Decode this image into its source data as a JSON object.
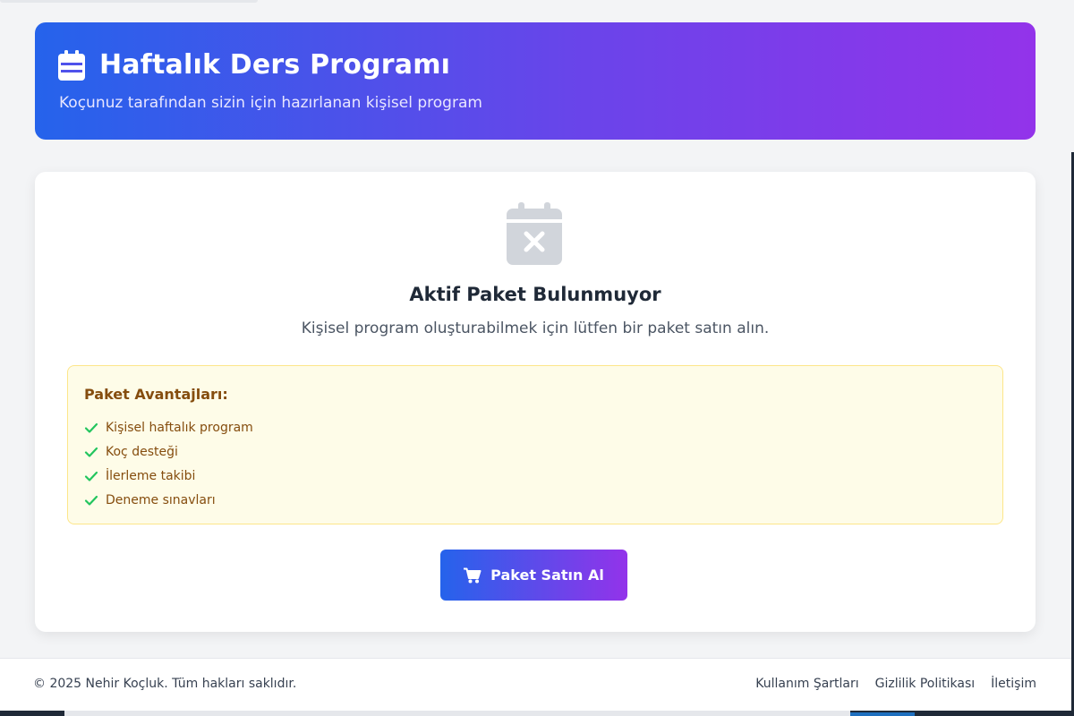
{
  "header": {
    "title": "Haftalık Ders Programı",
    "subtitle": "Koçunuz tarafından sizin için hazırlanan kişisel program",
    "icon": "calendar-icon"
  },
  "empty_state": {
    "icon": "calendar-x-icon",
    "title": "Aktif Paket Bulunmuyor",
    "description": "Kişisel program oluşturabilmek için lütfen bir paket satın alın."
  },
  "benefits": {
    "title": "Paket Avantajları:",
    "items": [
      "Kişisel haftalık program",
      "Koç desteği",
      "İlerleme takibi",
      "Deneme sınavları"
    ],
    "icon": "check-icon"
  },
  "buy_button": {
    "label": "Paket Satın Al",
    "icon": "cart-icon"
  },
  "footer": {
    "copyright": "© 2025 Nehir Koçluk. Tüm hakları saklıdır.",
    "links": [
      "Kullanım Şartları",
      "Gizlilik Politikası",
      "İletişim"
    ]
  },
  "colors": {
    "gradient_start": "#2563eb",
    "gradient_end": "#9333ea",
    "benefits_bg": "#fefce8",
    "benefits_text": "#854d0e",
    "check": "#22c55e"
  }
}
